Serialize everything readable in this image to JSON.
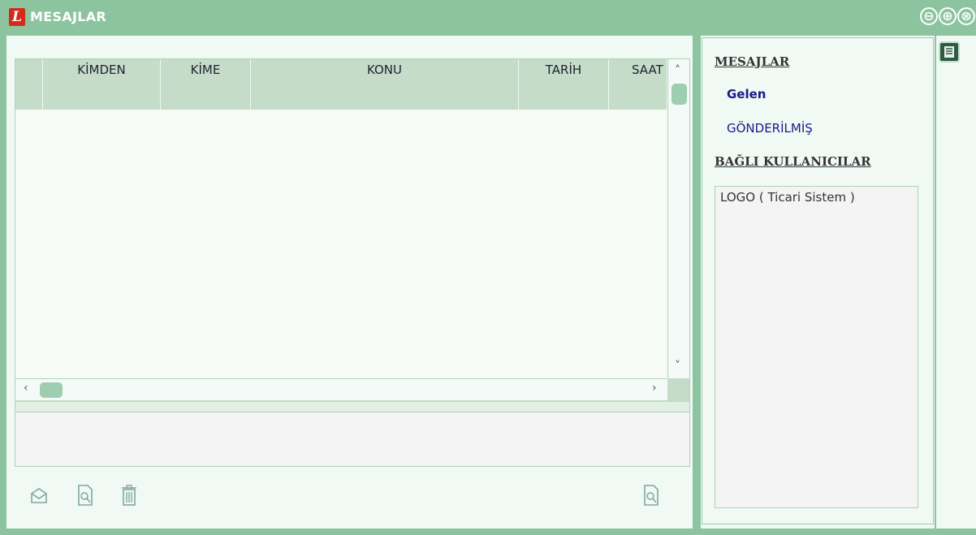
{
  "window": {
    "logo_letter": "L",
    "title": "MESAJLAR",
    "controls": [
      "⊖",
      "⊕",
      "⊗"
    ]
  },
  "grid": {
    "columns": [
      "KİMDEN",
      "KİME",
      "KONU",
      "TARİH",
      "SAAT"
    ],
    "rows": []
  },
  "scroll": {
    "up": "˄",
    "down": "˅",
    "left": "‹",
    "right": "›"
  },
  "side_panel": {
    "messages_heading": "MESAJLAR",
    "inbox_label": "Gelen",
    "sent_label": "GÖNDERİLMİŞ",
    "users_heading": "BAĞLI KULLANICILAR",
    "users": [
      "LOGO ( Ticari Sistem )"
    ]
  },
  "colors": {
    "frame": "#8cc4a0",
    "header": "#c4dcc8",
    "nav_link": "#1a1a8a"
  }
}
